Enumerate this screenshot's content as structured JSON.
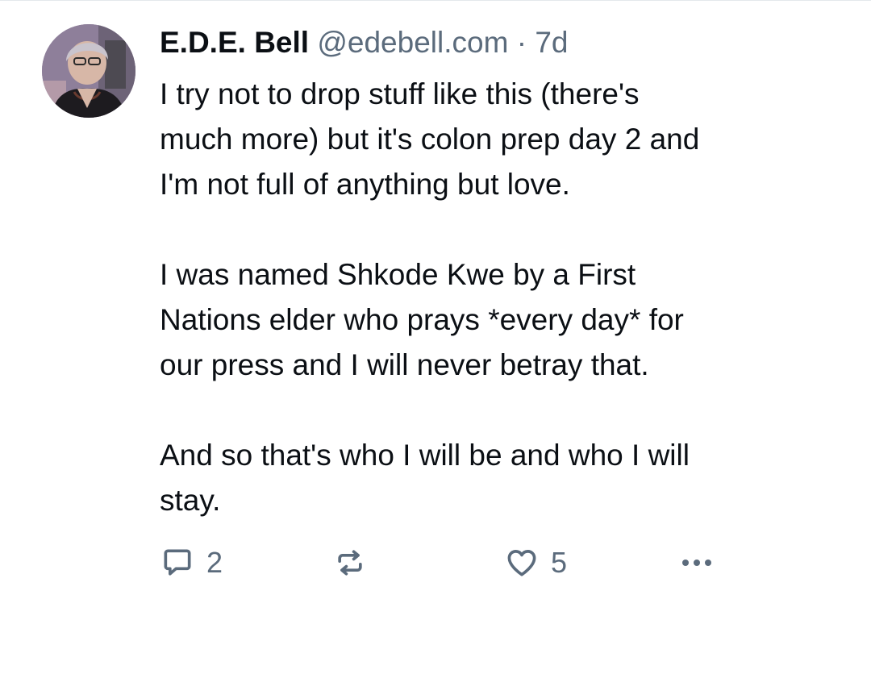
{
  "post": {
    "author": {
      "display_name": "E.D.E. Bell",
      "handle": "@edebell.com",
      "separator": "·",
      "time": "7d"
    },
    "paragraphs": [
      [
        "I try not to drop stuff like this (there's",
        "much more) but it's colon prep day 2 and",
        "I'm not full of anything but love."
      ],
      [
        "I was named Shkode Kwe by a First",
        "Nations elder who prays *every day* for",
        "our press and I will never betray that."
      ],
      [
        "And so that's who I will be and who I will",
        "stay."
      ]
    ],
    "actions": {
      "reply": {
        "icon": "reply-icon",
        "count": "2"
      },
      "repost": {
        "icon": "repost-icon",
        "count": ""
      },
      "like": {
        "icon": "heart-icon",
        "count": "5"
      },
      "more": {
        "icon": "more-dots-icon"
      }
    }
  },
  "colors": {
    "text": "#0b0f14",
    "muted": "#5b6b7c",
    "divider": "#e4e8ec",
    "background": "#ffffff"
  }
}
